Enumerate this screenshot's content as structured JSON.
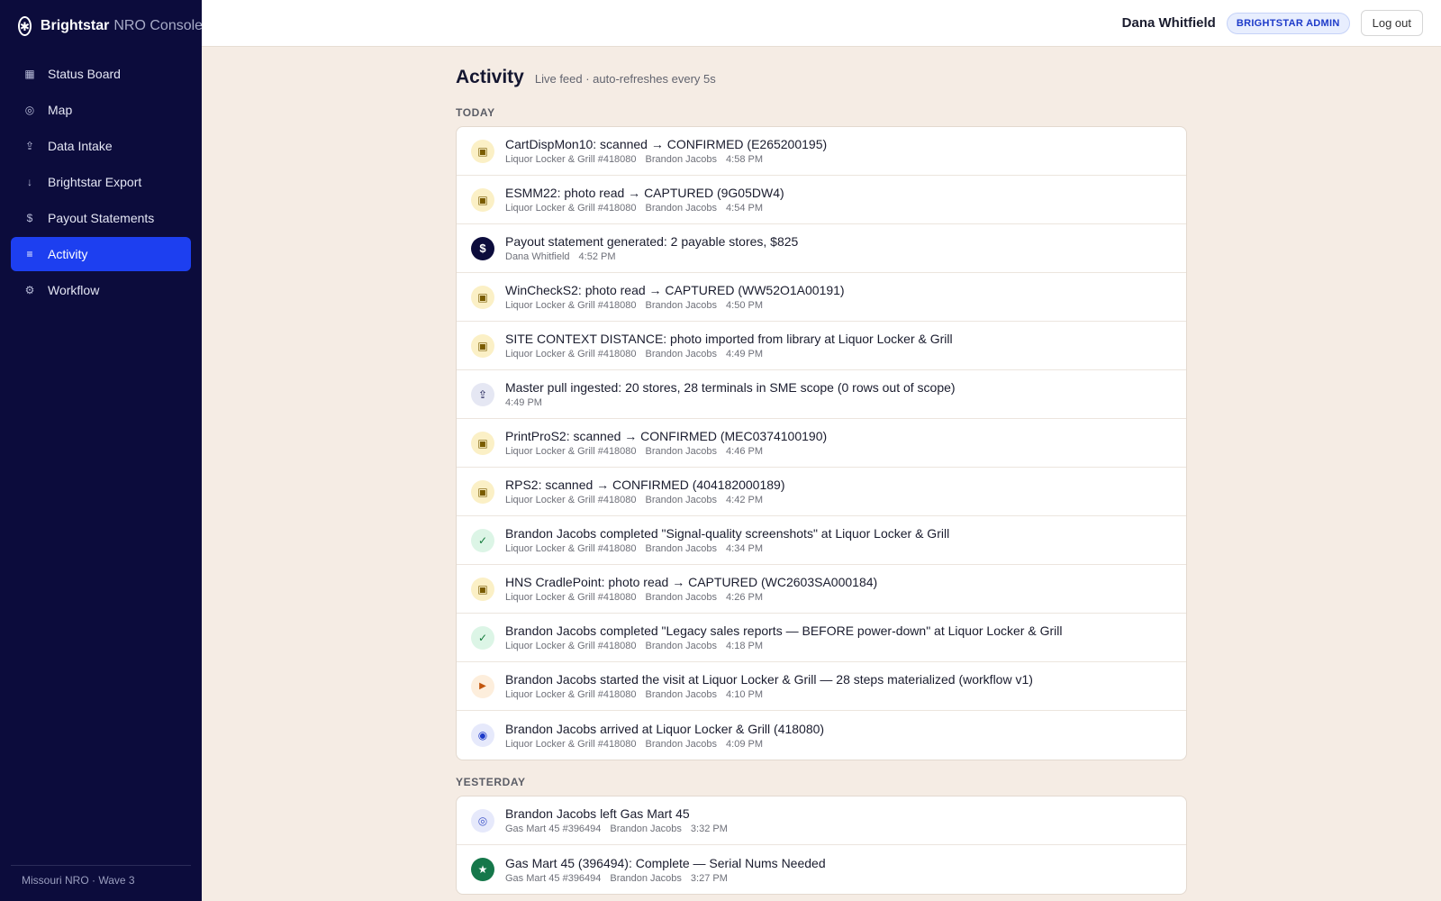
{
  "brand": {
    "name": "Brightstar",
    "subtitle": "NRO Console"
  },
  "sidebar": {
    "items": [
      {
        "label": "Status Board",
        "icon": "grid-icon"
      },
      {
        "label": "Map",
        "icon": "map-icon"
      },
      {
        "label": "Data Intake",
        "icon": "intake-icon"
      },
      {
        "label": "Brightstar Export",
        "icon": "export-icon"
      },
      {
        "label": "Payout Statements",
        "icon": "dollar-icon"
      },
      {
        "label": "Activity",
        "icon": "list-icon",
        "active": true
      },
      {
        "label": "Workflow",
        "icon": "workflow-icon"
      }
    ],
    "footer": "Missouri NRO · Wave 3"
  },
  "header": {
    "user_name": "Dana Whitfield",
    "role_badge": "BRIGHTSTAR ADMIN",
    "logout_label": "Log out"
  },
  "main": {
    "title": "Activity",
    "subtitle": "Live feed · auto-refreshes every 5s",
    "sections": [
      {
        "label": "TODAY",
        "events": [
          {
            "icon": "chip-icon",
            "title": "CartDispMon10: scanned → CONFIRMED (E265200195)",
            "store": "Liquor Locker & Grill #418080",
            "user": "Brandon Jacobs",
            "time": "4:58 PM"
          },
          {
            "icon": "chip-icon",
            "title": "ESMM22: photo read → CAPTURED (9G05DW4)",
            "store": "Liquor Locker & Grill #418080",
            "user": "Brandon Jacobs",
            "time": "4:54 PM"
          },
          {
            "icon": "dollar-icon",
            "title": "Payout statement generated: 2 payable stores, $825",
            "store": "",
            "user": "Dana Whitfield",
            "time": "4:52 PM"
          },
          {
            "icon": "chip-icon",
            "title": "WinCheckS2: photo read → CAPTURED (WW52O1A00191)",
            "store": "Liquor Locker & Grill #418080",
            "user": "Brandon Jacobs",
            "time": "4:50 PM"
          },
          {
            "icon": "chip-icon",
            "title": "SITE CONTEXT DISTANCE: photo imported from library at Liquor Locker & Grill",
            "store": "Liquor Locker & Grill #418080",
            "user": "Brandon Jacobs",
            "time": "4:49 PM"
          },
          {
            "icon": "intake-icon",
            "title": "Master pull ingested: 20 stores, 28 terminals in SME scope (0 rows out of scope)",
            "store": "",
            "user": "",
            "time": "4:49 PM"
          },
          {
            "icon": "chip-icon",
            "title": "PrintProS2: scanned → CONFIRMED (MEC0374100190)",
            "store": "Liquor Locker & Grill #418080",
            "user": "Brandon Jacobs",
            "time": "4:46 PM"
          },
          {
            "icon": "chip-icon",
            "title": "RPS2: scanned → CONFIRMED (404182000189)",
            "store": "Liquor Locker & Grill #418080",
            "user": "Brandon Jacobs",
            "time": "4:42 PM"
          },
          {
            "icon": "check-icon",
            "title": "Brandon Jacobs completed \"Signal-quality screenshots\" at Liquor Locker & Grill",
            "store": "Liquor Locker & Grill #418080",
            "user": "Brandon Jacobs",
            "time": "4:34 PM"
          },
          {
            "icon": "chip-icon",
            "title": "HNS CradlePoint: photo read → CAPTURED (WC2603SA000184)",
            "store": "Liquor Locker & Grill #418080",
            "user": "Brandon Jacobs",
            "time": "4:26 PM"
          },
          {
            "icon": "check-icon",
            "title": "Brandon Jacobs completed \"Legacy sales reports — BEFORE power-down\" at Liquor Locker & Grill",
            "store": "Liquor Locker & Grill #418080",
            "user": "Brandon Jacobs",
            "time": "4:18 PM"
          },
          {
            "icon": "play-icon",
            "title": "Brandon Jacobs started the visit at Liquor Locker & Grill — 28 steps materialized (workflow v1)",
            "store": "Liquor Locker & Grill #418080",
            "user": "Brandon Jacobs",
            "time": "4:10 PM"
          },
          {
            "icon": "arrive-icon",
            "title": "Brandon Jacobs arrived at Liquor Locker & Grill (418080)",
            "store": "Liquor Locker & Grill #418080",
            "user": "Brandon Jacobs",
            "time": "4:09 PM"
          }
        ]
      },
      {
        "label": "YESTERDAY",
        "events": [
          {
            "icon": "left-icon",
            "title": "Brandon Jacobs left Gas Mart 45",
            "store": "Gas Mart 45 #396494",
            "user": "Brandon Jacobs",
            "time": "3:32 PM"
          },
          {
            "icon": "star-icon",
            "title": "Gas Mart 45 (396494): Complete — Serial Nums Needed",
            "store": "Gas Mart 45 #396494",
            "user": "Brandon Jacobs",
            "time": "3:27 PM"
          }
        ]
      }
    ]
  }
}
